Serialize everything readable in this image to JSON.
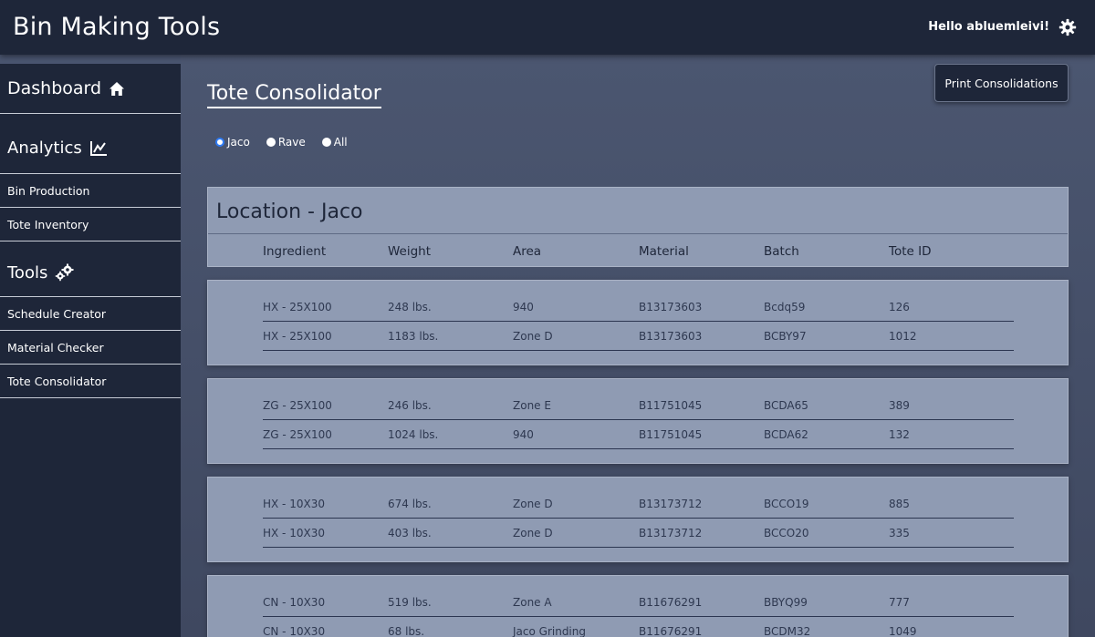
{
  "app": {
    "title": "Bin Making Tools",
    "greeting": "Hello abluemleivi!"
  },
  "sidebar": {
    "dashboard": "Dashboard",
    "analytics": "Analytics",
    "analytics_items": [
      "Bin Production",
      "Tote Inventory"
    ],
    "tools": "Tools",
    "tools_items": [
      "Schedule Creator",
      "Material Checker",
      "Tote Consolidator"
    ]
  },
  "main": {
    "title": "Tote Consolidator",
    "print_button": "Print Consolidations",
    "filters": [
      {
        "label": "Jaco",
        "selected": true
      },
      {
        "label": "Rave",
        "selected": false
      },
      {
        "label": "All",
        "selected": false
      }
    ],
    "location_title": "Location - Jaco",
    "columns": [
      "Ingredient",
      "Weight",
      "Area",
      "Material",
      "Batch",
      "Tote ID"
    ],
    "groups": [
      {
        "rows": [
          [
            "HX - 25X100",
            "248 lbs.",
            "940",
            "B13173603",
            "Bcdq59",
            "126"
          ],
          [
            "HX - 25X100",
            "1183 lbs.",
            "Zone D",
            "B13173603",
            "BCBY97",
            "1012"
          ]
        ]
      },
      {
        "rows": [
          [
            "ZG - 25X100",
            "246 lbs.",
            "Zone E",
            "B11751045",
            "BCDA65",
            "389"
          ],
          [
            "ZG - 25X100",
            "1024 lbs.",
            "940",
            "B11751045",
            "BCDA62",
            "132"
          ]
        ]
      },
      {
        "rows": [
          [
            "HX - 10X30",
            "674 lbs.",
            "Zone D",
            "B13173712",
            "BCCO19",
            "885"
          ],
          [
            "HX - 10X30",
            "403 lbs.",
            "Zone D",
            "B13173712",
            "BCCO20",
            "335"
          ]
        ]
      },
      {
        "rows": [
          [
            "CN - 10X30",
            "519 lbs.",
            "Zone A",
            "B11676291",
            "BBYQ99",
            "777"
          ],
          [
            "CN - 10X30",
            "68 lbs.",
            "Jaco Grinding",
            "B11676291",
            "BCDM32",
            "1049"
          ]
        ]
      }
    ]
  }
}
